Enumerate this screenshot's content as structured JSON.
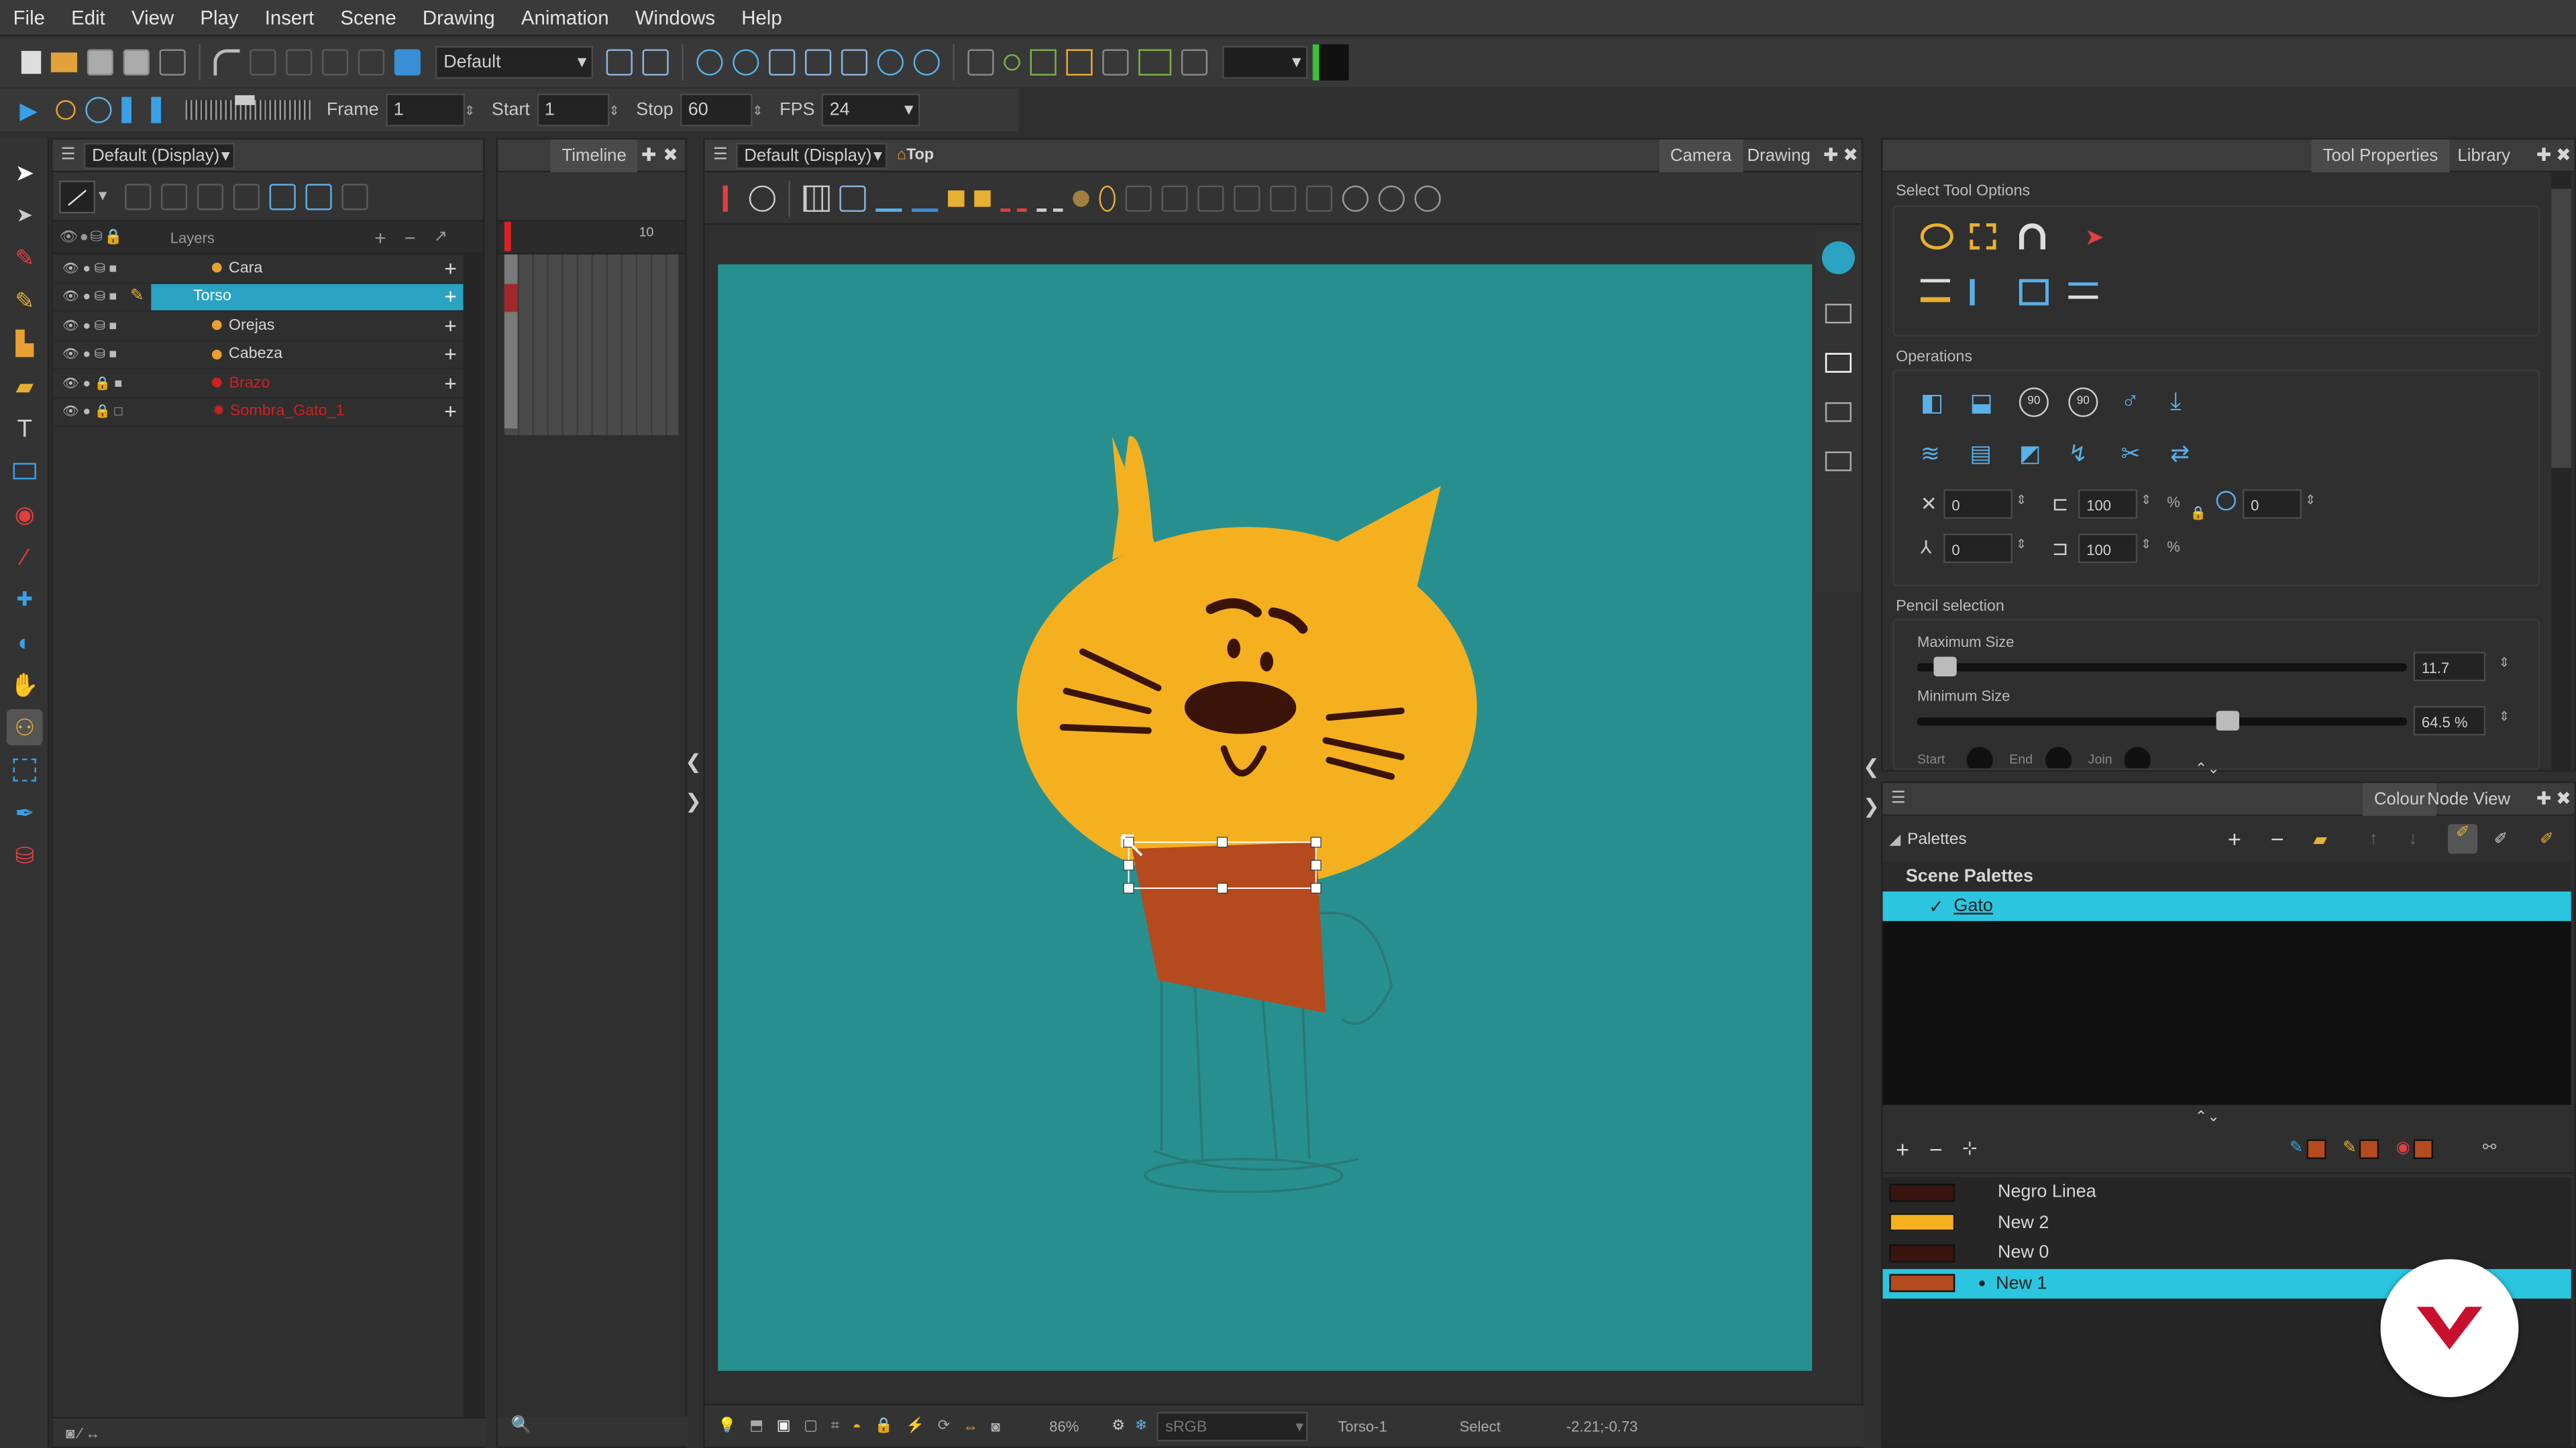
{
  "menu": [
    "File",
    "Edit",
    "View",
    "Play",
    "Insert",
    "Scene",
    "Drawing",
    "Animation",
    "Windows",
    "Help"
  ],
  "toolbar": {
    "preset": "Default",
    "frame_label": "Frame",
    "frame": "1",
    "start_label": "Start",
    "start": "1",
    "stop_label": "Stop",
    "stop": "60",
    "fps_label": "FPS",
    "fps": "24"
  },
  "layers_panel": {
    "view": "Default (Display)",
    "timeline_tab": "Timeline",
    "layers_header": "Layers",
    "ruler_mark": "10",
    "rows": [
      {
        "name": "Cara",
        "color": "#e8e8e8"
      },
      {
        "name": "Torso",
        "color": "#ffffff",
        "selected": true
      },
      {
        "name": "Orejas",
        "color": "#e8e8e8"
      },
      {
        "name": "Cabeza",
        "color": "#e8e8e8"
      },
      {
        "name": "Brazo",
        "color": "#cc2222"
      },
      {
        "name": "Sombra_Gato_1",
        "color": "#cc2222"
      }
    ]
  },
  "camera_view": {
    "view": "Default (Display)",
    "position": "Top",
    "tabs": [
      "Camera",
      "Drawing"
    ],
    "zoom": "86%",
    "colorspace": "sRGB",
    "drawing": "Torso-1",
    "tool": "Select",
    "coords": "-2.21;-0.73"
  },
  "tool_properties": {
    "tabs": [
      "Tool Properties",
      "Library"
    ],
    "select_options": "Select Tool Options",
    "operations": "Operations",
    "x": "0",
    "width": "100",
    "pct1": "%",
    "angle": "0",
    "y": "0",
    "height": "100",
    "pct2": "%",
    "pencil_section": "Pencil selection",
    "max_label": "Maximum Size",
    "max_value": "11.7",
    "min_label": "Minimum Size",
    "min_value": "64.5 %",
    "cutoff": [
      "Start",
      "End",
      "Join"
    ]
  },
  "colour_panel": {
    "tabs": [
      "Colour",
      "Node View"
    ],
    "palettes_label": "Palettes",
    "scene_palettes": "Scene Palettes",
    "palette": "Gato",
    "swatches": [
      {
        "name": "Negro Linea",
        "color": "#3a1510"
      },
      {
        "name": "New 2",
        "color": "#f5b020"
      },
      {
        "name": "New 0",
        "color": "#3a1510"
      },
      {
        "name": "New 1",
        "color": "#b54a1e",
        "selected": true
      }
    ]
  },
  "colors": {
    "canvas": "#27908e",
    "cat": "#f5b020",
    "torso": "#b54a1e",
    "dark": "#3b1409",
    "accent": "#2aa3c2"
  }
}
